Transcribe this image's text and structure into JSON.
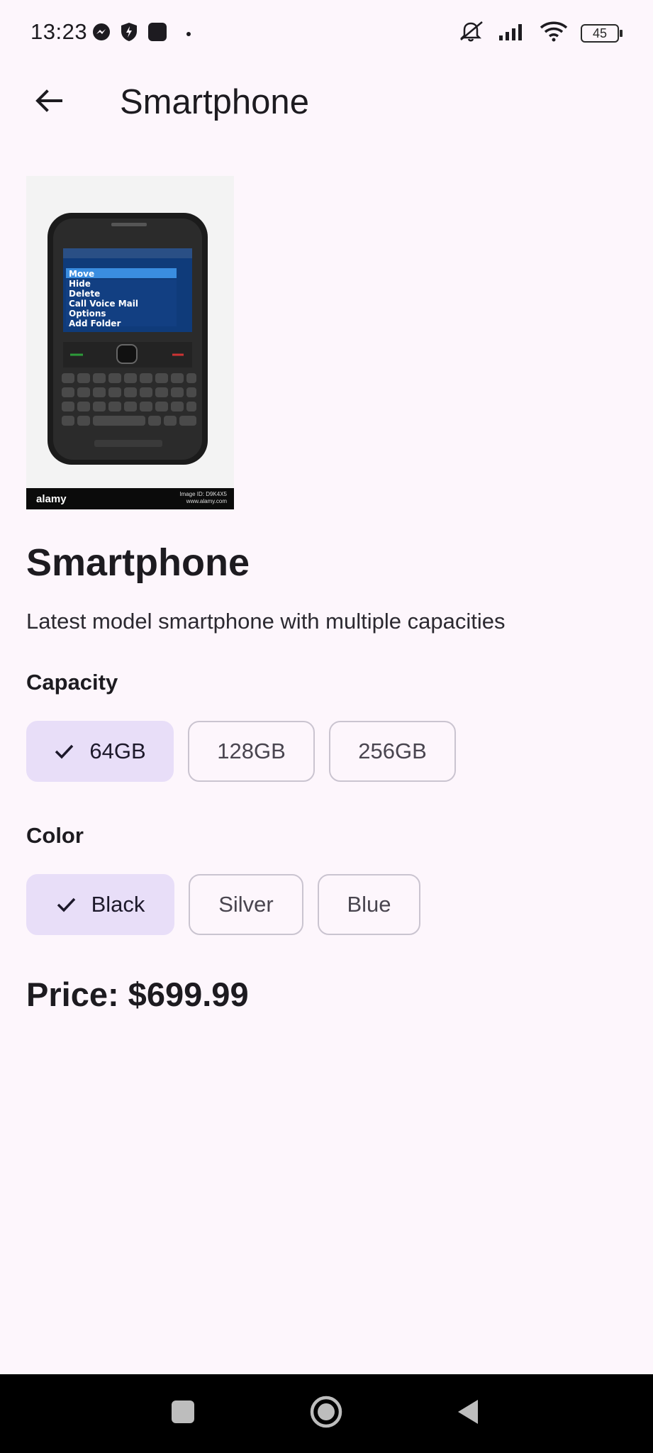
{
  "status_bar": {
    "time": "13:23",
    "battery": "45",
    "left_icons": [
      "messenger-icon",
      "shield-bolt-icon",
      "app-square-icon",
      "dot-icon"
    ],
    "right_icons": [
      "mute-icon",
      "signal-icon",
      "wifi-icon",
      "battery-icon"
    ]
  },
  "app_bar": {
    "title": "Smartphone",
    "back_icon": "arrow-back-icon"
  },
  "product": {
    "image_watermark_left": "alamy",
    "image_watermark_right_1": "Image ID: D9K4X5",
    "image_watermark_right_2": "www.alamy.com",
    "name": "Smartphone",
    "description": "Latest model smartphone with multiple capacities"
  },
  "capacity": {
    "label": "Capacity",
    "options": [
      "64GB",
      "128GB",
      "256GB"
    ],
    "selected": "64GB"
  },
  "color": {
    "label": "Color",
    "options": [
      "Black",
      "Silver",
      "Blue"
    ],
    "selected": "Black"
  },
  "price_text": "Price: $699.99",
  "colors": {
    "background": "#FDF6FC",
    "chip_selected": "#E8DEF8",
    "chip_border": "#CAC4D0",
    "text": "#1D1B20"
  },
  "nav": [
    "recents-square-icon",
    "home-circle-icon",
    "back-triangle-icon"
  ]
}
